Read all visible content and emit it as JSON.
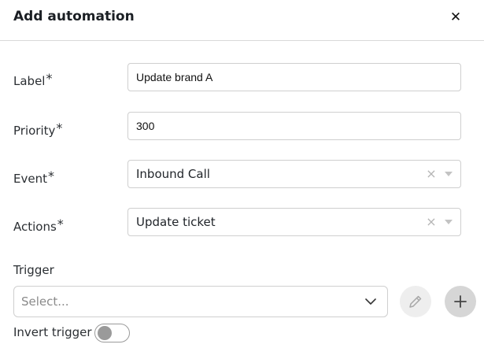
{
  "dialog": {
    "title": "Add automation",
    "close_icon": "close-icon"
  },
  "fields": {
    "label": {
      "label": "Label",
      "required_mark": "*",
      "value": "Update brand A"
    },
    "priority": {
      "label": "Priority",
      "required_mark": "*",
      "value": "300"
    },
    "event": {
      "label": "Event",
      "required_mark": "*",
      "value": "Inbound Call",
      "clear_glyph": "×"
    },
    "actions": {
      "label": "Actions",
      "required_mark": "*",
      "value": "Update ticket",
      "clear_glyph": "×"
    }
  },
  "trigger": {
    "label": "Trigger",
    "placeholder": "Select...",
    "edit_icon": "pencil-icon",
    "add_icon": "plus-icon"
  },
  "invert_trigger": {
    "label": "Invert trigger",
    "checked": false
  },
  "colors": {
    "border": "#cfcfcf",
    "muted_icon": "#b5b5b5",
    "edit_button_bg": "#eeeeee",
    "add_button_bg": "#d6d6d6",
    "toggle_off": "#9a9a9a"
  }
}
